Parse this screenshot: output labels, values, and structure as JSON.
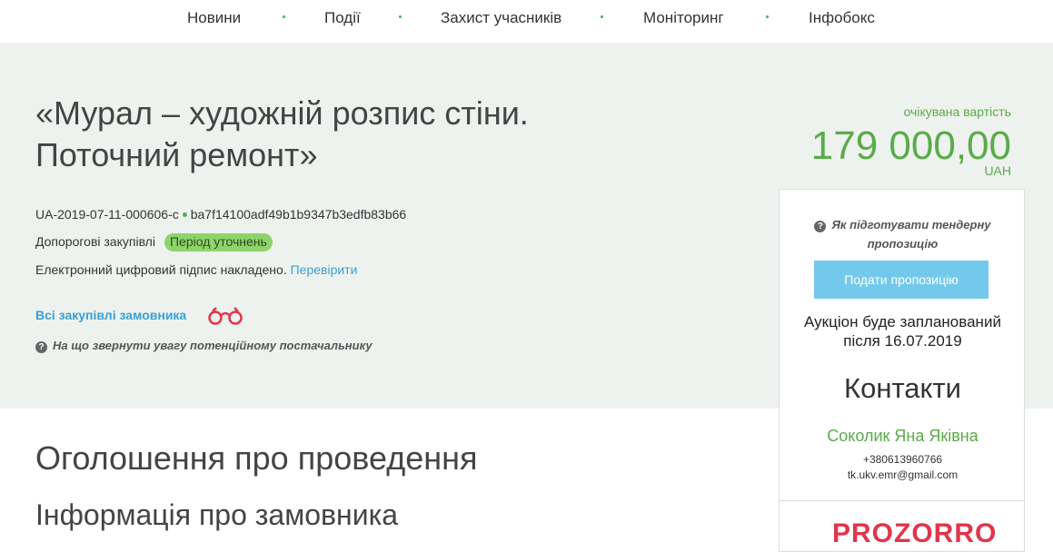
{
  "nav": {
    "items": [
      {
        "label": "Новини"
      },
      {
        "label": "Події"
      },
      {
        "label": "Захист учасників"
      },
      {
        "label": "Моніторинг"
      },
      {
        "label": "Інфобокс"
      }
    ]
  },
  "tender": {
    "title": "«Мурал – художній розпис стіни. Поточний ремонт»",
    "id": "UA-2019-07-11-000606-c",
    "hash": "ba7f14100adf49b1b9347b3edfb83b66",
    "procedure": "Допорогові закупівлі",
    "status": "Період уточнень",
    "signature_text": "Електронний цифровий підпис накладено.",
    "verify_link": "Перевірити",
    "customer_link": "Всі закупівлі замовника",
    "supplier_hint": "На що звернути увагу потенційному постачальнику"
  },
  "price": {
    "label": "очікувана вартість",
    "value": "179 000,00",
    "currency": "UAH"
  },
  "panel": {
    "prep_hint": "Як підготувати тендерну пропозицію",
    "submit_label": "Подати пропозицію",
    "auction_text": "Аукціон буде запланований після 16.07.2019",
    "contacts_title": "Контакти",
    "contact_name": "Соколик Яна Яківна",
    "contact_phone": "+380613960766",
    "contact_email": "tk.ukv.emr@gmail.com",
    "logo_text": "PROZORRO"
  },
  "main": {
    "section_title": "Оголошення про проведення",
    "subsection_title": "Інформація про замовника"
  },
  "colors": {
    "accent_green": "#5aab4a",
    "link_blue": "#3a9fd6",
    "hero_bg": "#eef2ee",
    "button_blue": "#73c9ec",
    "badge_green": "#8ed36b",
    "logo_red": "#e0354a"
  }
}
